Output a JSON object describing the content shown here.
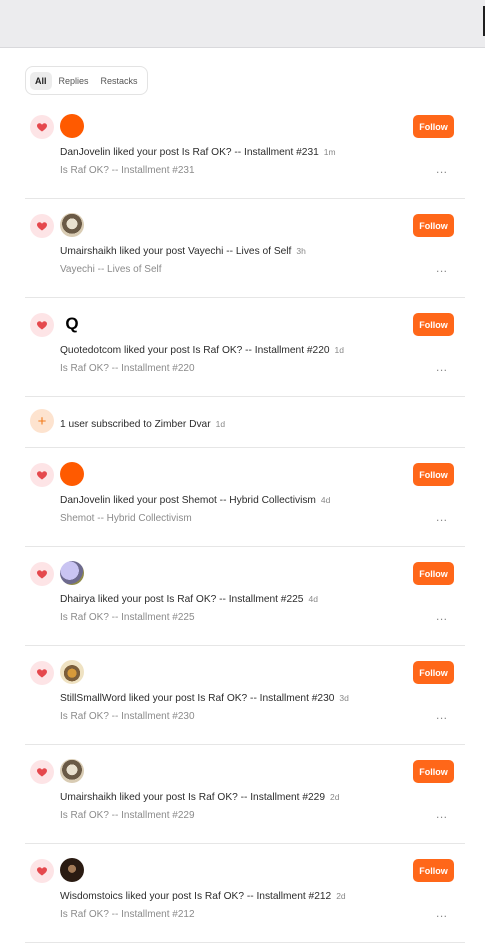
{
  "tabs": [
    {
      "label": "All",
      "active": true
    },
    {
      "label": "Replies",
      "active": false
    },
    {
      "label": "Restacks",
      "active": false
    }
  ],
  "follow_label": "Follow",
  "more_label": "...",
  "accent_color": "#ff6719",
  "notifications": [
    {
      "kind": "like",
      "avatar": "orange",
      "text": "DanJovelin liked your post Is Raf OK? -- Installment #231",
      "time": "1m",
      "post": "Is Raf OK? -- Installment #231"
    },
    {
      "kind": "like",
      "avatar": "dog",
      "text": "Umairshaikh liked your post Vayechi -- Lives of Self",
      "time": "3h",
      "post": "Vayechi -- Lives of Self"
    },
    {
      "kind": "like",
      "avatar": "q",
      "avatar_letter": "Q",
      "text": "Quotedotcom liked your post Is Raf OK? -- Installment #220",
      "time": "1d",
      "post": "Is Raf OK? -- Installment #220"
    },
    {
      "kind": "subscribe",
      "icon": "+",
      "text": "1 user subscribed to Zimber Dvar",
      "time": "1d"
    },
    {
      "kind": "like",
      "avatar": "orange",
      "text": "DanJovelin liked your post Shemot -- Hybrid Collectivism",
      "time": "4d",
      "post": "Shemot -- Hybrid Collectivism"
    },
    {
      "kind": "like",
      "avatar": "dhairya",
      "text": "Dhairya liked your post Is Raf OK? -- Installment #225",
      "time": "4d",
      "post": "Is Raf OK? -- Installment #225"
    },
    {
      "kind": "like",
      "avatar": "bird",
      "text": "StillSmallWord liked your post Is Raf OK? -- Installment #230",
      "time": "3d",
      "post": "Is Raf OK? -- Installment #230"
    },
    {
      "kind": "like",
      "avatar": "dog",
      "text": "Umairshaikh liked your post Is Raf OK? -- Installment #229",
      "time": "2d",
      "post": "Is Raf OK? -- Installment #229"
    },
    {
      "kind": "like",
      "avatar": "stoic",
      "text": "Wisdomstoics liked your post Is Raf OK? -- Installment #212",
      "time": "2d",
      "post": "Is Raf OK? -- Installment #212"
    }
  ]
}
